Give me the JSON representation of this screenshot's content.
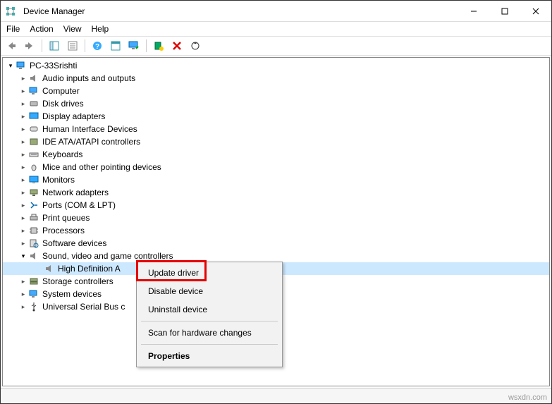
{
  "window": {
    "title": "Device Manager"
  },
  "menu": {
    "items": [
      "File",
      "Action",
      "View",
      "Help"
    ]
  },
  "tree": {
    "root": "PC-33Srishti",
    "categories": [
      "Audio inputs and outputs",
      "Computer",
      "Disk drives",
      "Display adapters",
      "Human Interface Devices",
      "IDE ATA/ATAPI controllers",
      "Keyboards",
      "Mice and other pointing devices",
      "Monitors",
      "Network adapters",
      "Ports (COM & LPT)",
      "Print queues",
      "Processors",
      "Software devices"
    ],
    "sound_category": "Sound, video and game controllers",
    "selected_device": "High Definition A",
    "tail_categories": [
      "Storage controllers",
      "System devices",
      "Universal Serial Bus c"
    ]
  },
  "context_menu": {
    "items": [
      "Update driver",
      "Disable device",
      "Uninstall device",
      "Scan for hardware changes",
      "Properties"
    ]
  },
  "watermark": "wsxdn.com"
}
